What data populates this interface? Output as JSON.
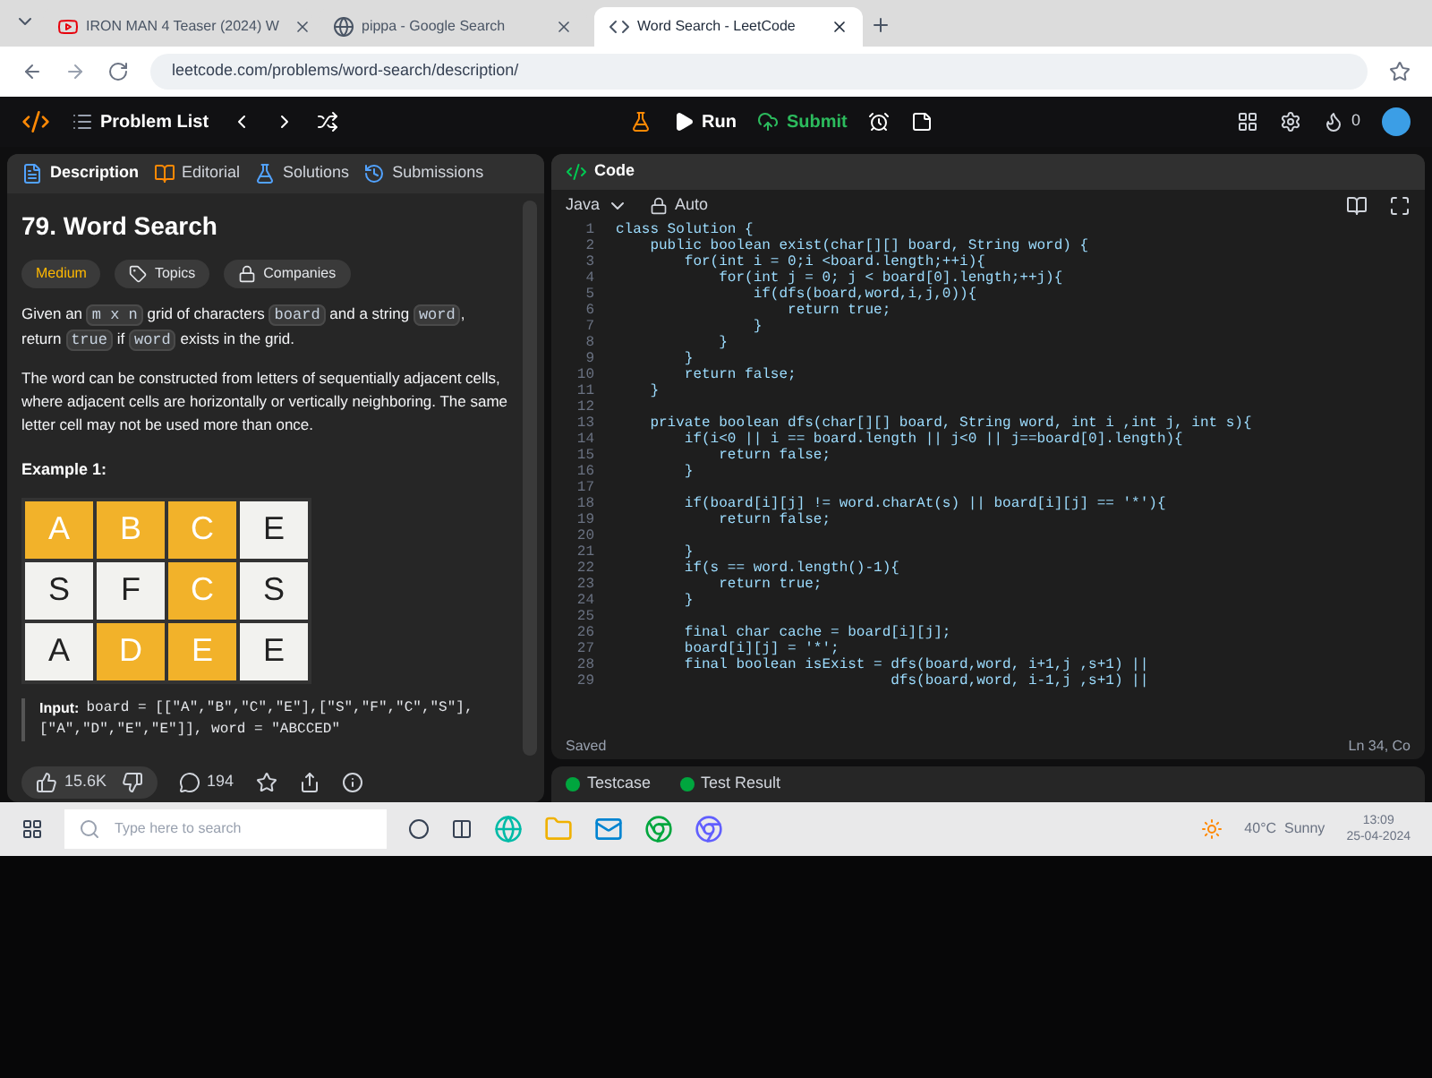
{
  "browser": {
    "tabs": [
      {
        "title": "IRON MAN 4 Teaser (2024) W",
        "selected": false,
        "kind": "video"
      },
      {
        "title": "pippa - Google Search",
        "selected": false,
        "kind": "search"
      },
      {
        "title": "Word Search - LeetCode",
        "selected": true,
        "kind": "leetcode"
      }
    ],
    "url": "leetcode.com/problems/word-search/description/"
  },
  "header": {
    "problem_list": "Problem List",
    "run": "Run",
    "submit": "Submit",
    "streak": "0"
  },
  "description_panel": {
    "tabs": [
      {
        "label": "Description",
        "selected": true
      },
      {
        "label": "Editorial",
        "selected": false
      },
      {
        "label": "Solutions",
        "selected": false
      },
      {
        "label": "Submissions",
        "selected": false
      }
    ],
    "title": "79. Word Search",
    "difficulty": "Medium",
    "tags": [
      "Topics",
      "Companies"
    ],
    "paragraphs": [
      [
        {
          "text": "Given an ",
          "code": false
        },
        {
          "text": "m x n",
          "code": true
        },
        {
          "text": " grid of characters ",
          "code": false
        },
        {
          "text": "board",
          "code": true
        },
        {
          "text": " and a string ",
          "code": false
        },
        {
          "text": "word",
          "code": true
        },
        {
          "text": ", return ",
          "code": false
        },
        {
          "text": "true",
          "code": true
        },
        {
          "text": " if ",
          "code": false
        },
        {
          "text": "word",
          "code": true
        },
        {
          "text": " exists in the grid.",
          "code": false
        }
      ],
      [
        {
          "text": "The word can be constructed from letters of sequentially adjacent cells, where adjacent cells are horizontally or vertically neighboring. The same letter cell may not be used more than once.",
          "code": false
        }
      ]
    ],
    "example_label": "Example 1:",
    "grid": [
      [
        {
          "letter": "A",
          "highlighted": true
        },
        {
          "letter": "B",
          "highlighted": true
        },
        {
          "letter": "C",
          "highlighted": true
        },
        {
          "letter": "E",
          "highlighted": false
        }
      ],
      [
        {
          "letter": "S",
          "highlighted": false
        },
        {
          "letter": "F",
          "highlighted": false
        },
        {
          "letter": "C",
          "highlighted": true
        },
        {
          "letter": "S",
          "highlighted": false
        }
      ],
      [
        {
          "letter": "A",
          "highlighted": false
        },
        {
          "letter": "D",
          "highlighted": true
        },
        {
          "letter": "E",
          "highlighted": true
        },
        {
          "letter": "E",
          "highlighted": false
        }
      ]
    ],
    "input_label": "Input:",
    "input_lines": [
      "board = [[\"A\",\"B\",\"C\",\"E\"],[\"S\",\"F\",\"C\",\"S\"],",
      "[\"A\",\"D\",\"E\",\"E\"]], word = \"ABCCED\""
    ],
    "likes": "15.6K",
    "comments": "194"
  },
  "code_panel": {
    "title": "Code",
    "language": "Java",
    "mode": "Auto",
    "lines": [
      {
        "n": "1",
        "code": "class Solution {"
      },
      {
        "n": "2",
        "code": "    public boolean exist(char[][] board, String word) {"
      },
      {
        "n": "3",
        "code": "        for(int i = 0;i <board.length;++i){"
      },
      {
        "n": "4",
        "code": "            for(int j = 0; j < board[0].length;++j){"
      },
      {
        "n": "5",
        "code": "                if(dfs(board,word,i,j,0)){"
      },
      {
        "n": "6",
        "code": "                    return true;"
      },
      {
        "n": "7",
        "code": "                }"
      },
      {
        "n": "8",
        "code": "            }"
      },
      {
        "n": "9",
        "code": "        }"
      },
      {
        "n": "10",
        "code": "        return false;"
      },
      {
        "n": "11",
        "code": "    }"
      },
      {
        "n": "12"
      },
      {
        "n": "13",
        "code": "    private boolean dfs(char[][] board, String word, int i ,int j, int s){"
      },
      {
        "n": "14",
        "code": "        if(i<0 || i == board.length || j<0 || j==board[0].length){"
      },
      {
        "n": "15",
        "code": "            return false;"
      },
      {
        "n": "16",
        "code": "        }"
      },
      {
        "n": "17"
      },
      {
        "n": "18",
        "code": "        if(board[i][j] != word.charAt(s) || board[i][j] == '*'){"
      },
      {
        "n": "19",
        "code": "            return false;"
      },
      {
        "n": "20"
      },
      {
        "n": "21",
        "code": "        }"
      },
      {
        "n": "22",
        "code": "        if(s == word.length()-1){"
      },
      {
        "n": "23",
        "code": "            return true;"
      },
      {
        "n": "24",
        "code": "        }"
      },
      {
        "n": "25"
      },
      {
        "n": "26",
        "code": "        final char cache = board[i][j];"
      },
      {
        "n": "27",
        "code": "        board[i][j] = '*';"
      },
      {
        "n": "28",
        "code": "        final boolean isExist = dfs(board,word, i+1,j ,s+1) ||"
      },
      {
        "n": "29",
        "code": "                                dfs(board,word, i-1,j ,s+1) ||"
      }
    ],
    "status": "Saved",
    "cursor": "Ln 34, Co",
    "bottom_tabs": [
      "Testcase",
      "Test Result"
    ]
  },
  "taskbar": {
    "search_placeholder": "Type here to search",
    "weather": "40°C  Sunny",
    "time": "13:09",
    "date": "25-04-2024"
  }
}
